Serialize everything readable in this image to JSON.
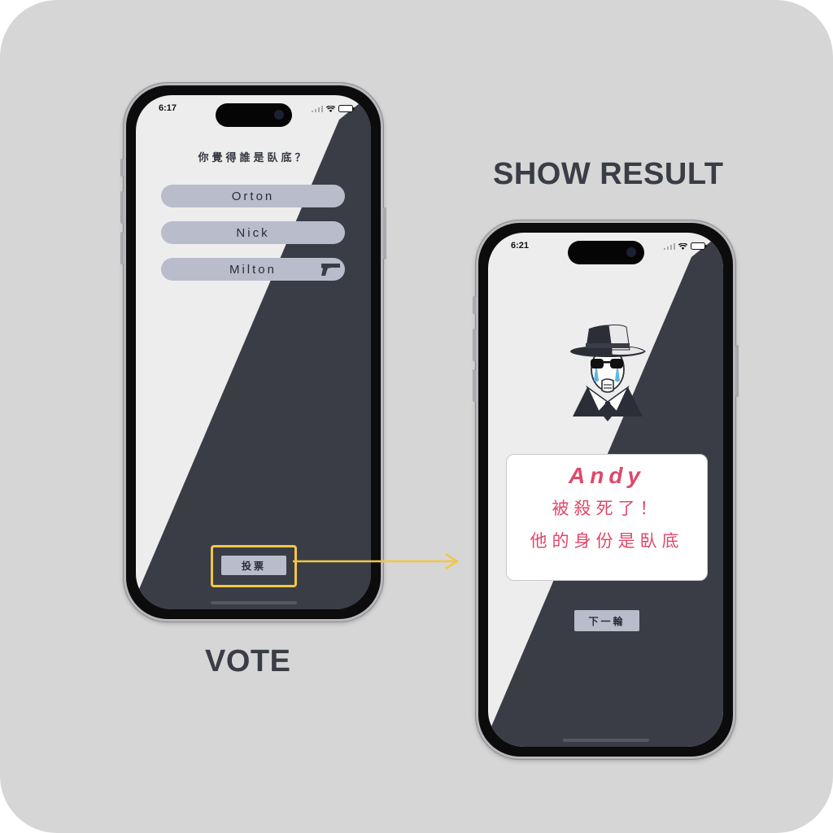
{
  "captions": {
    "result": "SHOW RESULT",
    "vote": "VOTE"
  },
  "vote_phone": {
    "time": "6:17",
    "question": "你覺得誰是臥底？",
    "options": [
      {
        "label": "Orton"
      },
      {
        "label": "Nick"
      },
      {
        "label": "Milton",
        "icon": "pistol-icon"
      }
    ],
    "vote_button": "投票"
  },
  "result_phone": {
    "time": "6:21",
    "illustration": "spy-crying-icon",
    "result": {
      "name": "Andy",
      "line1": "被殺死了！",
      "line2": "他的身份是臥底"
    },
    "next_button": "下一輪"
  },
  "colors": {
    "background": "#d6d6d6",
    "screen_light": "#ededed",
    "screen_dark": "#3a3d46",
    "option_fill": "#b9bccb",
    "highlight": "#f3c548",
    "result_text": "#e0476a"
  }
}
